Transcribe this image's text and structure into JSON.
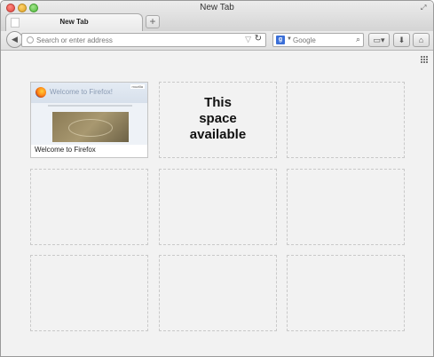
{
  "window": {
    "title": "New Tab"
  },
  "tabs": [
    {
      "label": "New Tab"
    }
  ],
  "new_tab_label": "+",
  "urlbar": {
    "placeholder": "Search or enter address"
  },
  "searchbar": {
    "placeholder": "Google",
    "engine_icon": "google-icon",
    "engine_letter": "g"
  },
  "content": {
    "tiles": [
      {
        "caption": "Welcome to Firefox",
        "thumb_title": "Welcome to Firefox!",
        "thumb_badge": "mozilla"
      },
      {
        "text": "This space available"
      },
      {},
      {},
      {},
      {},
      {},
      {},
      {}
    ]
  }
}
